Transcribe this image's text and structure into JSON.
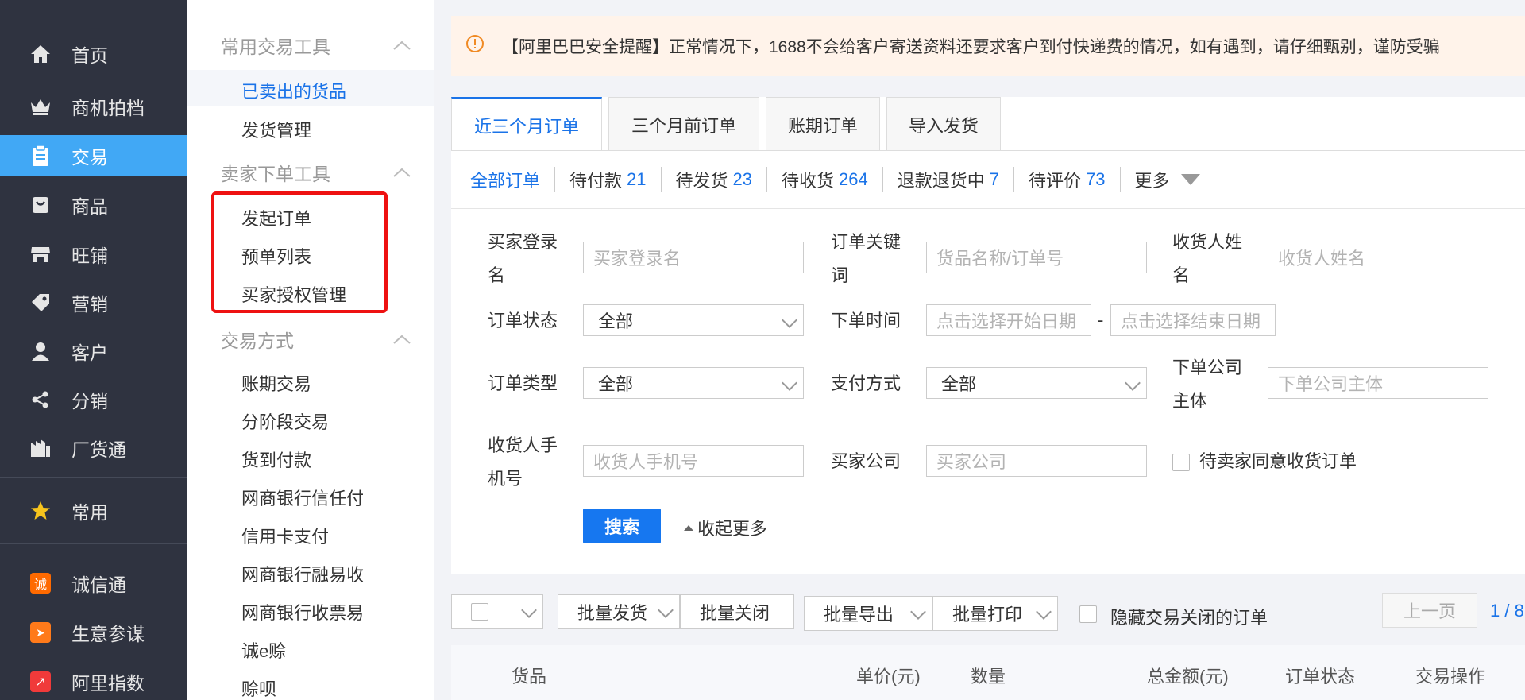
{
  "nav": {
    "items": [
      {
        "label": "首页",
        "icon": "home-icon"
      },
      {
        "label": "商机拍档",
        "icon": "crown-icon"
      },
      {
        "label": "交易",
        "icon": "clipboard-icon"
      },
      {
        "label": "商品",
        "icon": "bag-icon"
      },
      {
        "label": "旺铺",
        "icon": "store-icon"
      },
      {
        "label": "营销",
        "icon": "tag-icon"
      },
      {
        "label": "客户",
        "icon": "user-icon"
      },
      {
        "label": "分销",
        "icon": "share-icon"
      },
      {
        "label": "厂货通",
        "icon": "factory-icon"
      }
    ],
    "common": {
      "label": "常用",
      "icon": "star-icon"
    },
    "apps": [
      {
        "label": "诚信通",
        "icon": "chengxintong-icon",
        "badge": "诚",
        "color": "#ff6a00"
      },
      {
        "label": "生意参谋",
        "icon": "compass-icon",
        "badge": "➤",
        "color": "#ff7a1a"
      },
      {
        "label": "阿里指数",
        "icon": "trend-icon",
        "badge": "↗",
        "color": "#f03a3a"
      }
    ]
  },
  "submenu": {
    "group1": {
      "title": "常用交易工具",
      "items": [
        "已卖出的货品",
        "发货管理"
      ]
    },
    "group2": {
      "title": "卖家下单工具",
      "items": [
        "发起订单",
        "预单列表",
        "买家授权管理"
      ]
    },
    "group3": {
      "title": "交易方式",
      "items": [
        "账期交易",
        "分阶段交易",
        "货到付款",
        "网商银行信任付",
        "信用卡支付",
        "网商银行融易收",
        "网商银行收票易",
        "诚e赊",
        "赊呗"
      ]
    }
  },
  "notice": {
    "text": "【阿里巴巴安全提醒】正常情况下，1688不会给客户寄送资料还要求客户到付快递费的情况，如有遇到，请仔细甄别，谨防受骗"
  },
  "tabs": [
    "近三个月订单",
    "三个月前订单",
    "账期订单",
    "导入发货"
  ],
  "filters": [
    {
      "label": "全部订单",
      "count": ""
    },
    {
      "label": "待付款",
      "count": "21"
    },
    {
      "label": "待发货",
      "count": "23"
    },
    {
      "label": "待收货",
      "count": "264"
    },
    {
      "label": "退款退货中",
      "count": "7"
    },
    {
      "label": "待评价",
      "count": "73"
    },
    {
      "label": "更多",
      "count": ""
    }
  ],
  "form": {
    "buyer_login": {
      "label1": "买家登录",
      "label2": "名",
      "placeholder": "买家登录名"
    },
    "order_keyword": {
      "label1": "订单关键",
      "label2": "词",
      "placeholder": "货品名称/订单号"
    },
    "receiver_name": {
      "label1": "收货人姓",
      "label2": "名",
      "placeholder": "收货人姓名"
    },
    "order_status": {
      "label": "订单状态",
      "value": "全部"
    },
    "order_time": {
      "label": "下单时间",
      "start_placeholder": "点击选择开始日期",
      "end_placeholder": "点击选择结束日期",
      "sep": "-"
    },
    "order_type": {
      "label": "订单类型",
      "value": "全部"
    },
    "payment": {
      "label": "支付方式",
      "value": "全部"
    },
    "company_subject": {
      "label1": "下单公司",
      "label2": "主体",
      "placeholder": "下单公司主体"
    },
    "receiver_phone": {
      "label1": "收货人手",
      "label2": "机号",
      "placeholder": "收货人手机号"
    },
    "buyer_company": {
      "label": "买家公司",
      "placeholder": "买家公司"
    },
    "pending_agree": {
      "label": "待卖家同意收货订单"
    },
    "search_button": "搜索",
    "collapse": "收起更多"
  },
  "toolbar": {
    "batch_ship": "批量发货",
    "batch_close": "批量关闭",
    "batch_export": "批量导出",
    "batch_print": "批量打印",
    "hide_closed": "隐藏交易关闭的订单",
    "prev_page": "上一页",
    "page": "1 / 8"
  },
  "table_header": [
    "货品",
    "单价(元)",
    "数量",
    "总金额(元)",
    "订单状态",
    "交易操作"
  ]
}
